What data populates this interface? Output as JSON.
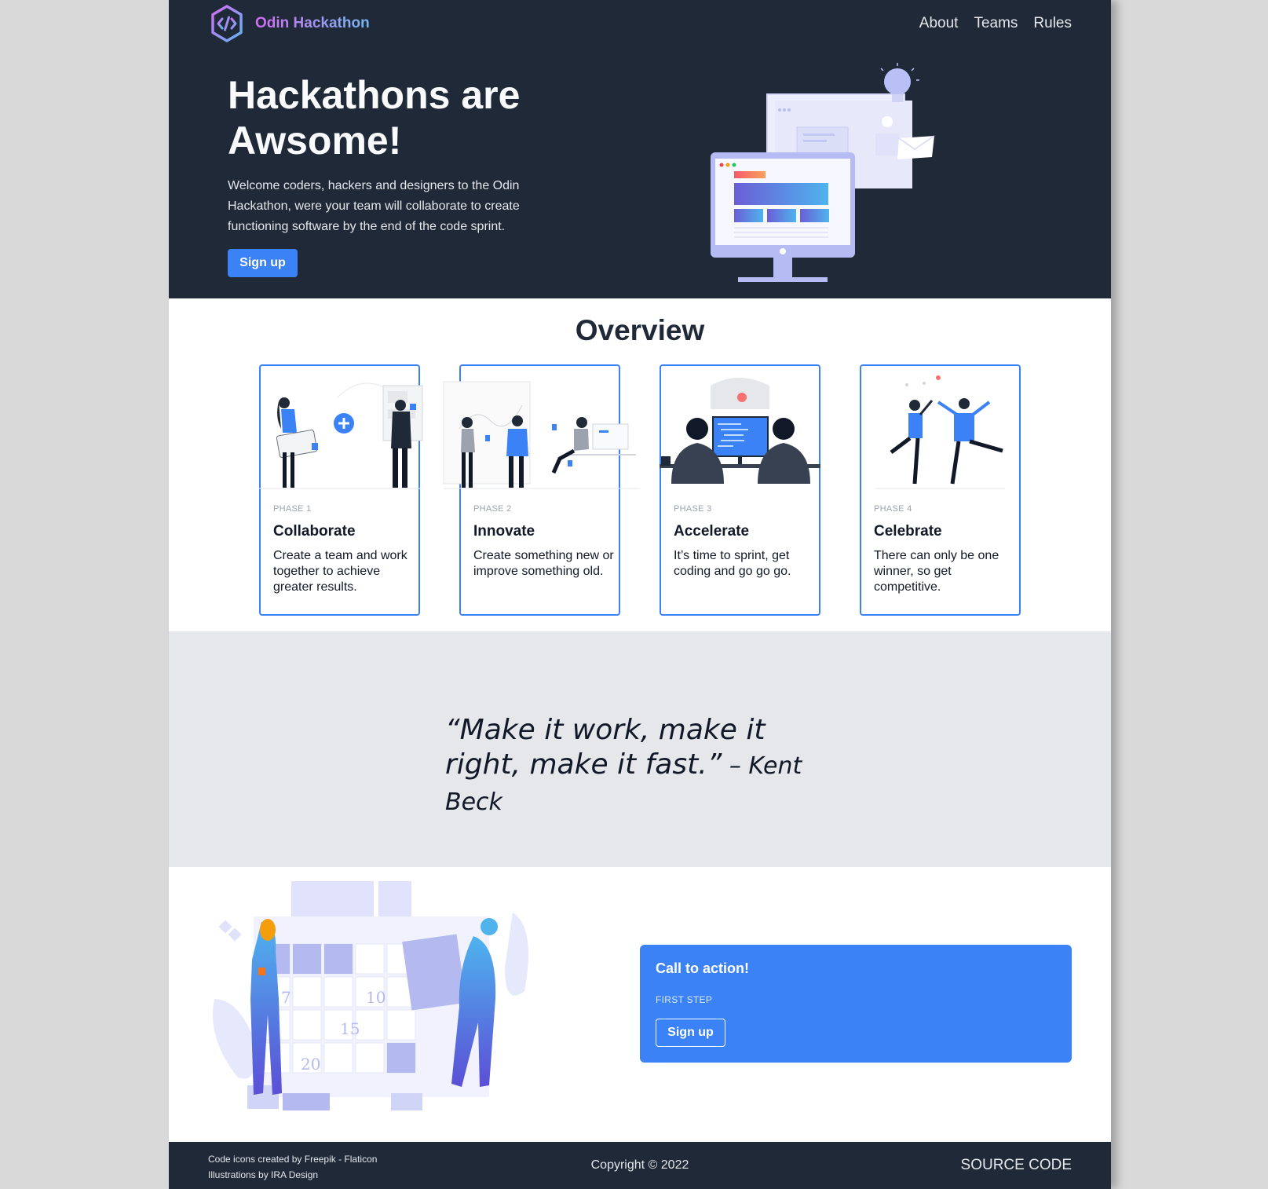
{
  "header": {
    "brand": "Odin Hackathon",
    "nav": [
      "About",
      "Teams",
      "Rules"
    ]
  },
  "hero": {
    "title": "Hackathons are Awsome!",
    "text": "Welcome coders, hackers and designers to the Odin Hackathon, were your team will collaborate to create functioning software by the end of the code sprint.",
    "button": "Sign up"
  },
  "overview": {
    "title": "Overview",
    "cards": [
      {
        "phase": "PHASE 1",
        "title": "Collaborate",
        "text": "Create a team and work together to achieve greater results."
      },
      {
        "phase": "PHASE 2",
        "title": "Innovate",
        "text": "Create something new or improve something old."
      },
      {
        "phase": "PHASE 3",
        "title": "Accelerate",
        "text": "It’s time to sprint, get coding and go go go."
      },
      {
        "phase": "PHASE 4",
        "title": "Celebrate",
        "text": "There can only be one winner, so get competitive."
      }
    ]
  },
  "quote": {
    "text": "“Make it work, make it right, make it fast.”",
    "author": " – Kent Beck"
  },
  "cta": {
    "title": "Call to action!",
    "subtitle": "FIRST STEP",
    "button": "Sign up"
  },
  "footer": {
    "credit_icons": "Code icons created by Freepik - Flaticon",
    "credit_illustrations": "Illustrations by IRA Design",
    "copyright": "Copyright © 2022",
    "source": "SOURCE CODE"
  },
  "colors": {
    "dark": "#1f2937",
    "accent": "#3b82f6",
    "band": "#e5e7eb"
  }
}
